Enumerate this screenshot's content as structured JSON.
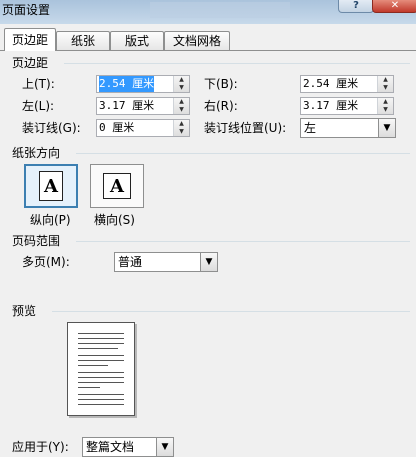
{
  "window": {
    "title": "页面设置"
  },
  "titlebar": {
    "help_glyph": "?",
    "close_glyph": "✕"
  },
  "tabs": [
    "页边距",
    "纸张",
    "版式",
    "文档网格"
  ],
  "margins": {
    "section": "页边距",
    "top": {
      "label": "上(T):",
      "value": "2.54 厘米"
    },
    "bottom": {
      "label": "下(B):",
      "value": "2.54 厘米"
    },
    "left": {
      "label": "左(L):",
      "value": "3.17 厘米"
    },
    "right": {
      "label": "右(R):",
      "value": "3.17 厘米"
    },
    "gutter": {
      "label": "装订线(G):",
      "value": "0 厘米"
    },
    "gutter_position": {
      "label": "装订线位置(U):",
      "value": "左"
    }
  },
  "orientation": {
    "section": "纸张方向",
    "icon_glyph": "A",
    "portrait_label": "纵向(P)",
    "landscape_label": "横向(S)",
    "selected": "portrait"
  },
  "pages": {
    "section": "页码范围",
    "multiple_label": "多页(M):",
    "multiple_value": "普通"
  },
  "preview": {
    "section": "预览"
  },
  "apply": {
    "label": "应用于(Y):",
    "value": "整篇文档"
  },
  "icons": {
    "spin_up": "▲",
    "spin_down": "▼",
    "dropdown": "▼"
  },
  "colors": {
    "selection": "#3399ff",
    "selected_border": "#3c7fb1"
  }
}
